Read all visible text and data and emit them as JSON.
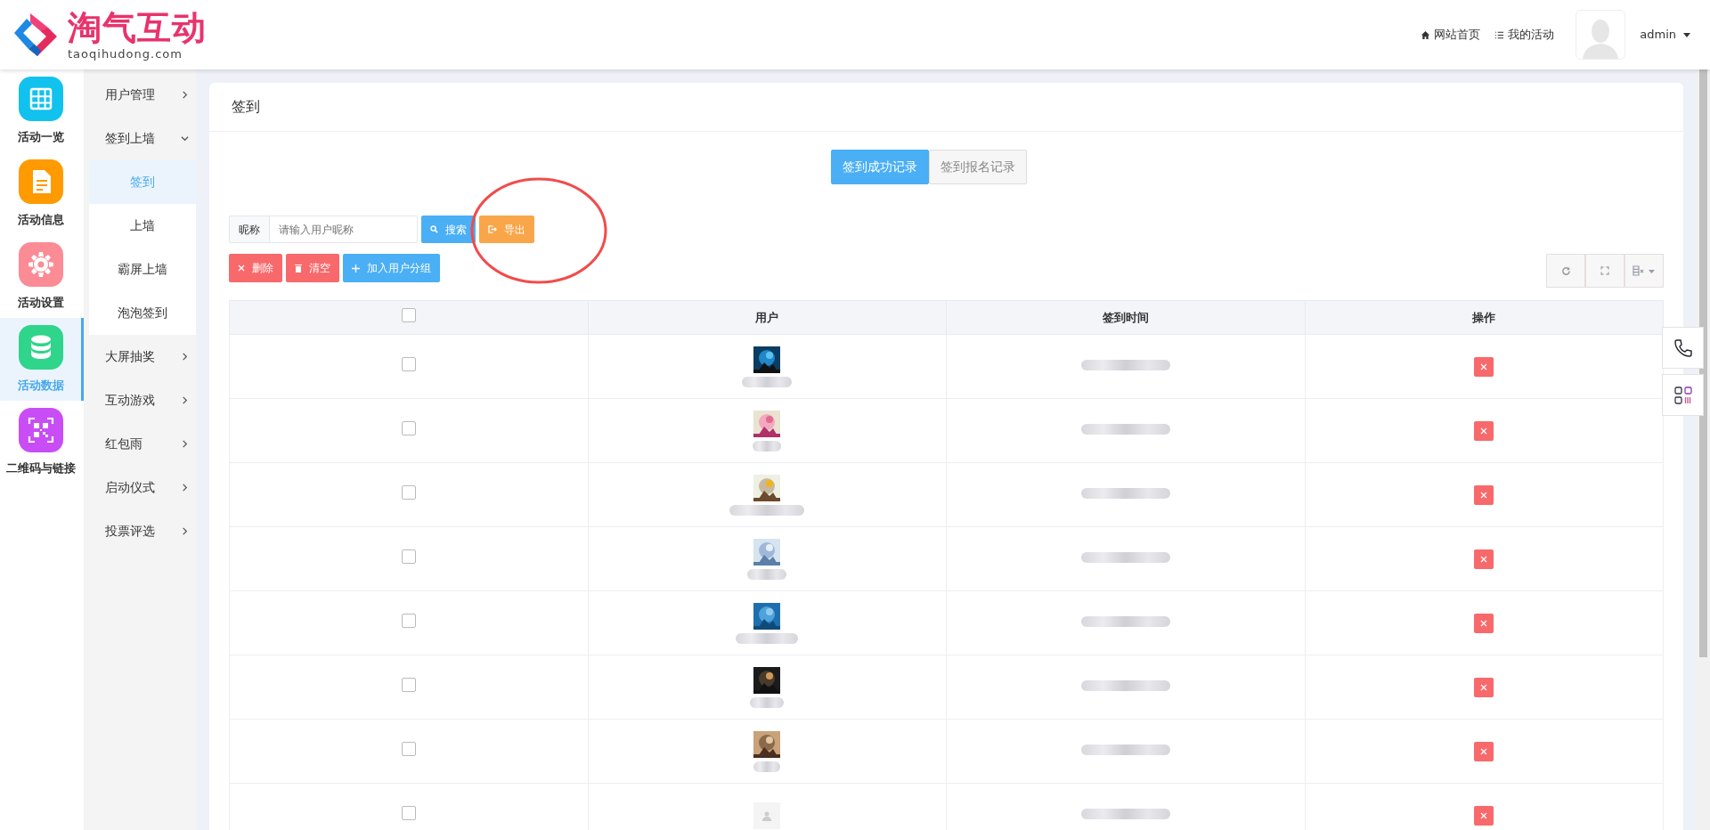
{
  "logo": {
    "title": "淘气互动",
    "domain": "taoqihudong.com"
  },
  "header": {
    "links": [
      {
        "label": "网站首页"
      },
      {
        "label": "我的活动"
      }
    ],
    "user": "admin"
  },
  "sidebar": {
    "items": [
      {
        "label": "活动一览",
        "color": "#12c2ee",
        "selected": false
      },
      {
        "label": "活动信息",
        "color": "#ff9a00",
        "selected": false
      },
      {
        "label": "活动设置",
        "color": "#fb8b94",
        "selected": false
      },
      {
        "label": "活动数据",
        "color": "#2fd58a",
        "selected": true
      },
      {
        "label": "二维码与链接",
        "color": "#c94df5",
        "selected": false
      }
    ]
  },
  "submenu": {
    "items": [
      {
        "label": "用户管理",
        "expanded": false
      },
      {
        "label": "签到上墙",
        "expanded": true,
        "children": [
          {
            "label": "签到",
            "selected": true
          },
          {
            "label": "上墙",
            "selected": false
          },
          {
            "label": "霸屏上墙",
            "selected": false
          },
          {
            "label": "泡泡签到",
            "selected": false
          }
        ]
      },
      {
        "label": "大屏抽奖",
        "expanded": false
      },
      {
        "label": "互动游戏",
        "expanded": false
      },
      {
        "label": "红包雨",
        "expanded": false
      },
      {
        "label": "启动仪式",
        "expanded": false
      },
      {
        "label": "投票评选",
        "expanded": false
      }
    ]
  },
  "panel": {
    "title": "签到",
    "tabs": [
      {
        "label": "签到成功记录",
        "selected": true
      },
      {
        "label": "签到报名记录",
        "selected": false
      }
    ],
    "search": {
      "label": "昵称",
      "placeholder": "请输入用户昵称",
      "button": "搜索"
    },
    "export_button": "导出",
    "actions": [
      {
        "kind": "delete",
        "label": "删除"
      },
      {
        "kind": "clear",
        "label": "清空"
      },
      {
        "kind": "add",
        "label": "加入用户分组"
      }
    ],
    "table": {
      "select_all": {
        "checked": false
      },
      "columns": [
        "用户",
        "签到时间",
        "操作"
      ],
      "rows": [
        {
          "checked": false,
          "kind": "picture"
        },
        {
          "checked": false,
          "kind": "picture"
        },
        {
          "checked": false,
          "kind": "picture"
        },
        {
          "checked": false,
          "kind": "picture"
        },
        {
          "checked": false,
          "kind": "picture"
        },
        {
          "checked": false,
          "kind": "picture"
        },
        {
          "checked": false,
          "kind": "picture"
        },
        {
          "checked": false,
          "kind": "placeholder"
        }
      ]
    }
  },
  "annotation": {
    "kind": "ellipse"
  }
}
